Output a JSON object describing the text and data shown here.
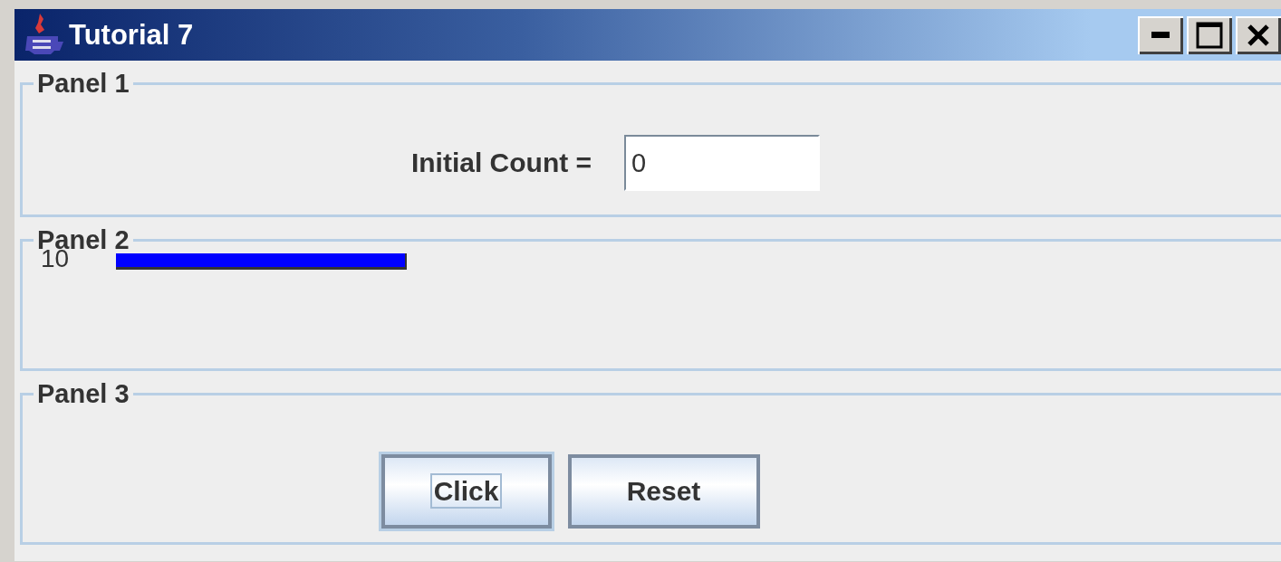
{
  "window": {
    "title": "Tutorial 7"
  },
  "panels": [
    {
      "title": "Panel 1",
      "kind": "field",
      "label": "Initial Count =",
      "value": "0"
    },
    {
      "title": "Panel 2",
      "kind": "meter",
      "reading": "10"
    },
    {
      "title": "Panel 3",
      "kind": "buttons",
      "buttons": [
        {
          "label": "Click",
          "focused": true
        },
        {
          "label": "Reset",
          "focused": false
        }
      ]
    }
  ]
}
